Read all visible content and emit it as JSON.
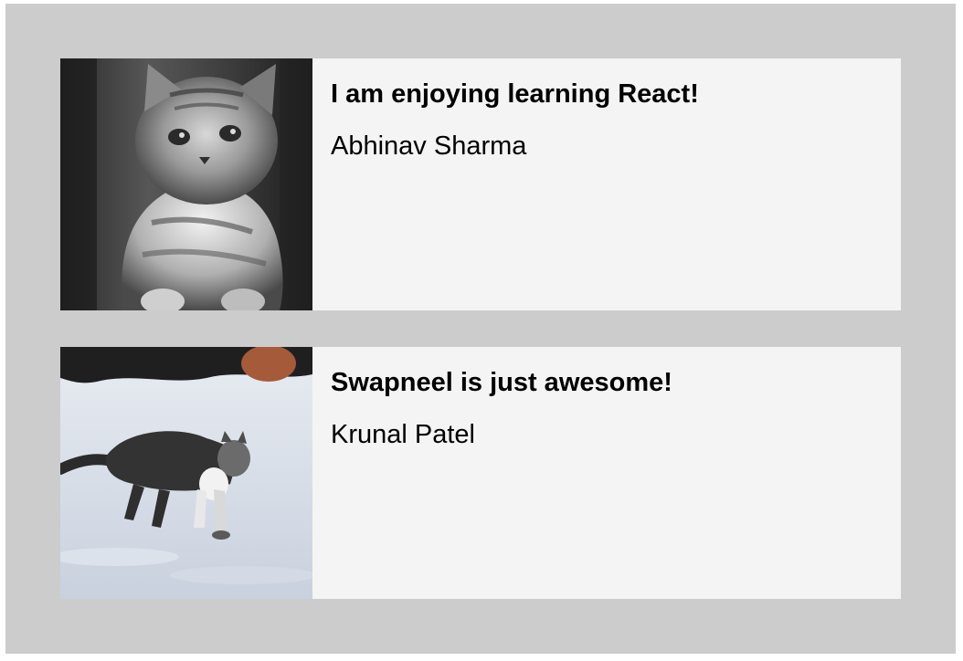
{
  "cards": [
    {
      "image": "kitten-photo",
      "quote": "I am enjoying learning React!",
      "author": "Abhinav Sharma"
    },
    {
      "image": "cat-in-snow-photo",
      "quote": "Swapneel is just awesome!",
      "author": "Krunal Patel"
    }
  ],
  "colors": {
    "page_background": "#cccccc",
    "card_background": "#f4f4f4",
    "text": "#000000"
  }
}
